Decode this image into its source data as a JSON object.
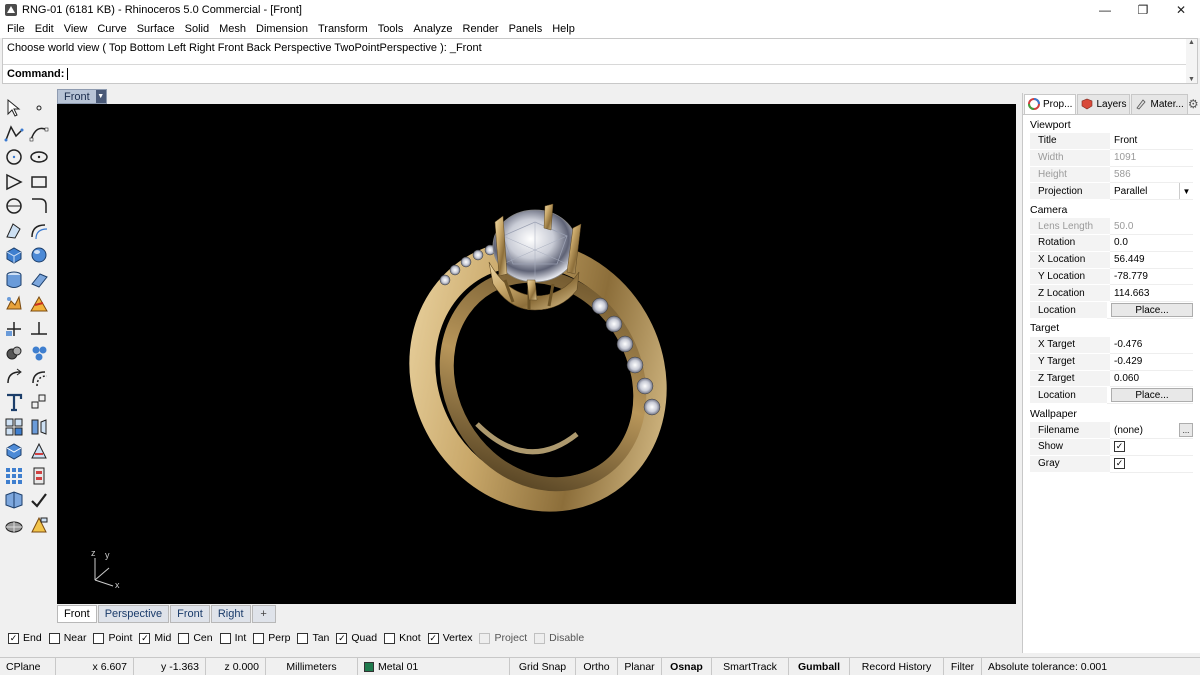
{
  "window": {
    "title": "RNG-01 (6181 KB) - Rhinoceros 5.0 Commercial - [Front]",
    "minimize": "—",
    "maximize": "❐",
    "close": "✕"
  },
  "menu": [
    "File",
    "Edit",
    "View",
    "Curve",
    "Surface",
    "Solid",
    "Mesh",
    "Dimension",
    "Transform",
    "Tools",
    "Analyze",
    "Render",
    "Panels",
    "Help"
  ],
  "command": {
    "history": "Choose world view ( Top  Bottom  Left  Right  Front  Back  Perspective  TwoPointPerspective ): _Front",
    "label": "Command:"
  },
  "viewport": {
    "tab_label": "Front",
    "axes": {
      "z": "z",
      "y": "y",
      "x": "x"
    }
  },
  "view_tabs": [
    "Front",
    "Perspective",
    "Front",
    "Right"
  ],
  "view_tab_add": "+",
  "panel": {
    "tabs": [
      {
        "label": "Prop...",
        "icon": "properties-icon"
      },
      {
        "label": "Layers",
        "icon": "layers-icon"
      },
      {
        "label": "Mater...",
        "icon": "materials-icon"
      }
    ],
    "sections": {
      "viewport": "Viewport",
      "camera": "Camera",
      "target": "Target",
      "wallpaper": "Wallpaper"
    },
    "viewport_props": {
      "title_label": "Title",
      "title_value": "Front",
      "width_label": "Width",
      "width_value": "1091",
      "height_label": "Height",
      "height_value": "586",
      "projection_label": "Projection",
      "projection_value": "Parallel"
    },
    "camera_props": {
      "lens_label": "Lens Length",
      "lens_value": "50.0",
      "rotation_label": "Rotation",
      "rotation_value": "0.0",
      "x_label": "X Location",
      "x_value": "56.449",
      "y_label": "Y Location",
      "y_value": "-78.779",
      "z_label": "Z Location",
      "z_value": "114.663",
      "location_label": "Location",
      "location_button": "Place..."
    },
    "target_props": {
      "x_label": "X Target",
      "x_value": "-0.476",
      "y_label": "Y Target",
      "y_value": "-0.429",
      "z_label": "Z Target",
      "z_value": "0.060",
      "location_label": "Location",
      "location_button": "Place..."
    },
    "wallpaper_props": {
      "filename_label": "Filename",
      "filename_value": "(none)",
      "filename_button": "...",
      "show_label": "Show",
      "show_checked": true,
      "gray_label": "Gray",
      "gray_checked": true
    }
  },
  "osnaps": [
    {
      "label": "End",
      "checked": true
    },
    {
      "label": "Near",
      "checked": false
    },
    {
      "label": "Point",
      "checked": false
    },
    {
      "label": "Mid",
      "checked": true
    },
    {
      "label": "Cen",
      "checked": false
    },
    {
      "label": "Int",
      "checked": false
    },
    {
      "label": "Perp",
      "checked": false
    },
    {
      "label": "Tan",
      "checked": false
    },
    {
      "label": "Quad",
      "checked": true
    },
    {
      "label": "Knot",
      "checked": false
    },
    {
      "label": "Vertex",
      "checked": true
    },
    {
      "label": "Project",
      "checked": false,
      "dim": true
    },
    {
      "label": "Disable",
      "checked": false,
      "dim": true
    }
  ],
  "status": {
    "cplane": "CPlane",
    "x": "x 6.607",
    "y": "y -1.363",
    "z": "z 0.000",
    "units": "Millimeters",
    "layer": "Metal 01",
    "layer_color": "#1f7a4d",
    "grid_snap": "Grid Snap",
    "ortho": "Ortho",
    "planar": "Planar",
    "osnap": "Osnap",
    "smarttrack": "SmartTrack",
    "gumball": "Gumball",
    "record_history": "Record History",
    "filter": "Filter",
    "tolerance": "Absolute tolerance: 0.001"
  },
  "toolbar_icons": [
    [
      "select-arrow-icon",
      "point-icon"
    ],
    [
      "polyline-icon",
      "curve-icon"
    ],
    [
      "circle-icon",
      "ellipse-icon"
    ],
    [
      "arc-icon",
      "rectangle-icon"
    ],
    [
      "polygon-icon",
      "fillet-curve-icon"
    ],
    [
      "offset-curve-icon",
      "surface-edge-icon"
    ],
    [
      "box-icon",
      "sphere-icon"
    ],
    [
      "cylinder-icon",
      "extrude-icon"
    ],
    [
      "explode-icon",
      "boolean-split-icon"
    ],
    [
      "trim-icon",
      "split-icon"
    ],
    [
      "boolean-union-icon",
      "group-icon"
    ],
    [
      "rotate-icon",
      "scale-icon"
    ],
    [
      "text-icon",
      "dimension-icon"
    ],
    [
      "array-icon",
      "mirror-icon"
    ],
    [
      "block-icon",
      "analyze-icon"
    ],
    [
      "grid-icon",
      "layer-state-icon"
    ],
    [
      "render-icon",
      "check-icon"
    ],
    [
      "mesh-icon",
      "light-icon"
    ]
  ]
}
